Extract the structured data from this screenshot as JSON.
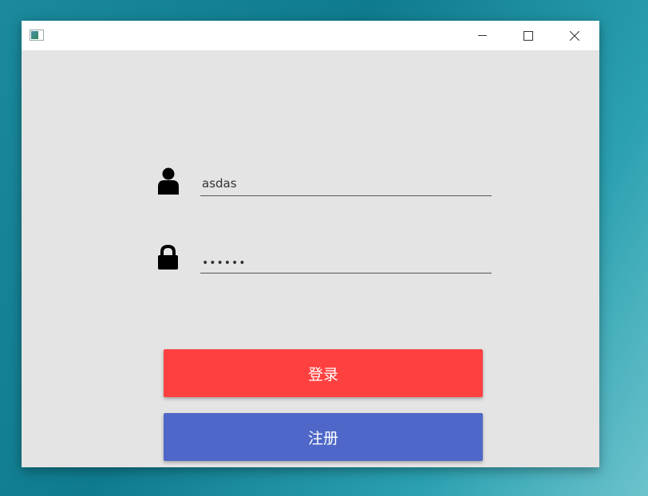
{
  "window": {
    "icon": "app-window-icon"
  },
  "login_form": {
    "username": {
      "icon": "user-icon",
      "value": "asdas"
    },
    "password": {
      "icon": "lock-icon",
      "value": "••••••"
    },
    "login_label": "登录",
    "register_label": "注册"
  },
  "colors": {
    "login": "#ff4040",
    "register": "#4e67c8",
    "background": "#e4e4e4"
  }
}
